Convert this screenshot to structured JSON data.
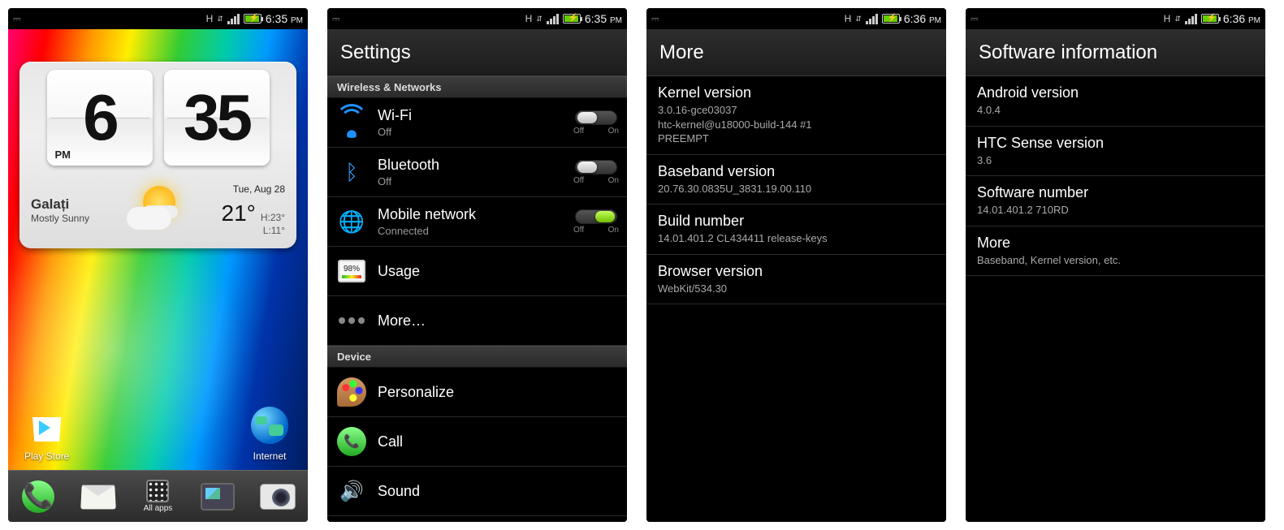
{
  "status": {
    "h_indicator": "H",
    "time_a": "6:35",
    "time_b": "6:36",
    "ampm": "PM"
  },
  "home": {
    "clock": {
      "hour": "6",
      "minute": "35",
      "ampm": "PM"
    },
    "city": "Galați",
    "condition": "Mostly Sunny",
    "date": "Tue, Aug 28",
    "temp": "21°",
    "high": "H:23°",
    "low": "L:11°",
    "apps": {
      "play": "Play Store",
      "internet": "Internet"
    },
    "dock": {
      "all_apps": "All apps"
    }
  },
  "settings": {
    "title": "Settings",
    "section_wireless": "Wireless & Networks",
    "section_device": "Device",
    "toggle_off": "Off",
    "toggle_on": "On",
    "wifi": {
      "label": "Wi-Fi",
      "sub": "Off",
      "state": "off"
    },
    "bt": {
      "label": "Bluetooth",
      "sub": "Off",
      "state": "off"
    },
    "net": {
      "label": "Mobile network",
      "sub": "Connected",
      "state": "on"
    },
    "usage": {
      "label": "Usage",
      "pct": "98%"
    },
    "more": {
      "label": "More…"
    },
    "personalize": {
      "label": "Personalize"
    },
    "call": {
      "label": "Call"
    },
    "sound": {
      "label": "Sound"
    }
  },
  "more_page": {
    "title": "More",
    "items": [
      {
        "title": "Kernel version",
        "sub": "3.0.16-gce03037\nhtc-kernel@u18000-build-144 #1\nPREEMPT"
      },
      {
        "title": "Baseband version",
        "sub": "20.76.30.0835U_3831.19.00.110"
      },
      {
        "title": "Build number",
        "sub": "14.01.401.2 CL434411 release-keys"
      },
      {
        "title": "Browser version",
        "sub": "WebKit/534.30"
      }
    ]
  },
  "swinfo_page": {
    "title": "Software information",
    "items": [
      {
        "title": "Android version",
        "sub": "4.0.4"
      },
      {
        "title": "HTC Sense version",
        "sub": "3.6"
      },
      {
        "title": "Software number",
        "sub": "14.01.401.2 710RD"
      },
      {
        "title": "More",
        "sub": "Baseband, Kernel version, etc."
      }
    ]
  }
}
